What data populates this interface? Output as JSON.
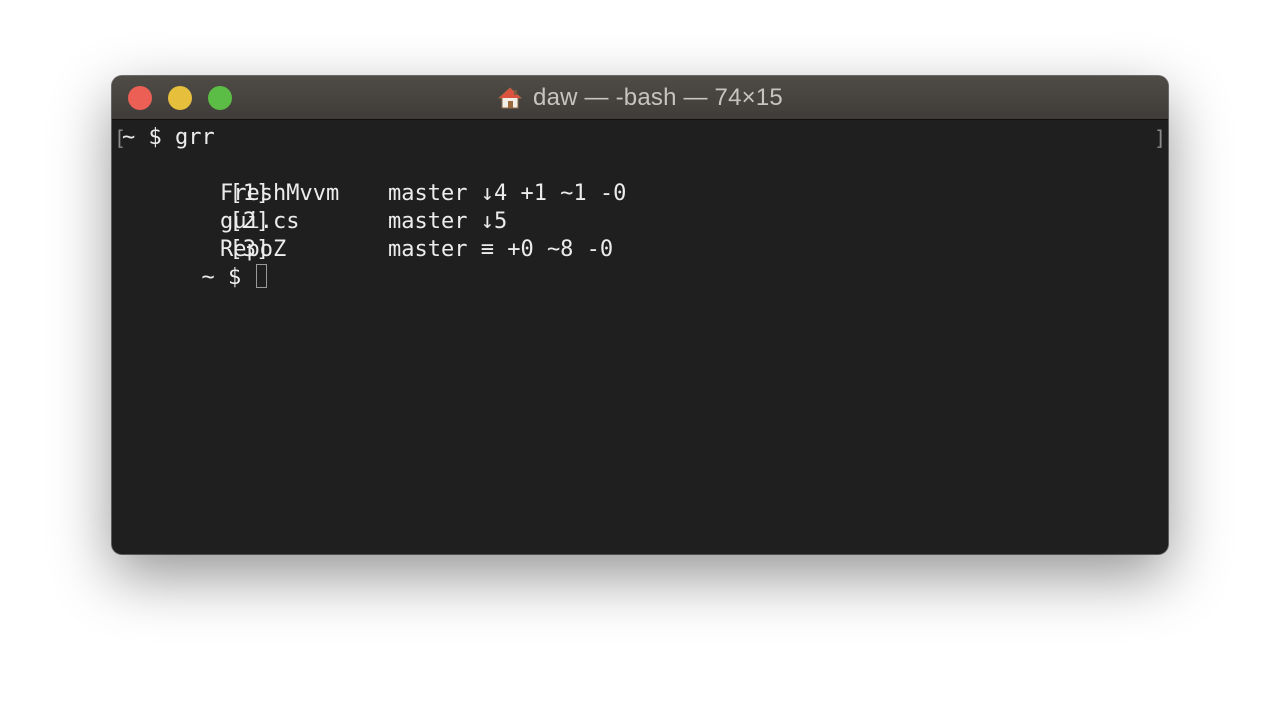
{
  "window": {
    "title": "daw — -bash — 74×15",
    "icon": "home-icon"
  },
  "traffic_lights": {
    "close_color": "#ec5f55",
    "minimize_color": "#e6bf3d",
    "zoom_color": "#5cbd46"
  },
  "terminal": {
    "command_line": "~ $ grr",
    "repos": [
      {
        "index": "[1]",
        "name": "FreshMvvm",
        "status": "master ↓4 +1 ~1 -0"
      },
      {
        "index": "[2]",
        "name": "gui.cs",
        "status": "master ↓5"
      },
      {
        "index": "[3]",
        "name": "RepoZ",
        "status": "master ≡ +0 ~8 -0"
      }
    ],
    "prompt": "~ $ ",
    "mark_left": "[",
    "mark_right": "]"
  }
}
